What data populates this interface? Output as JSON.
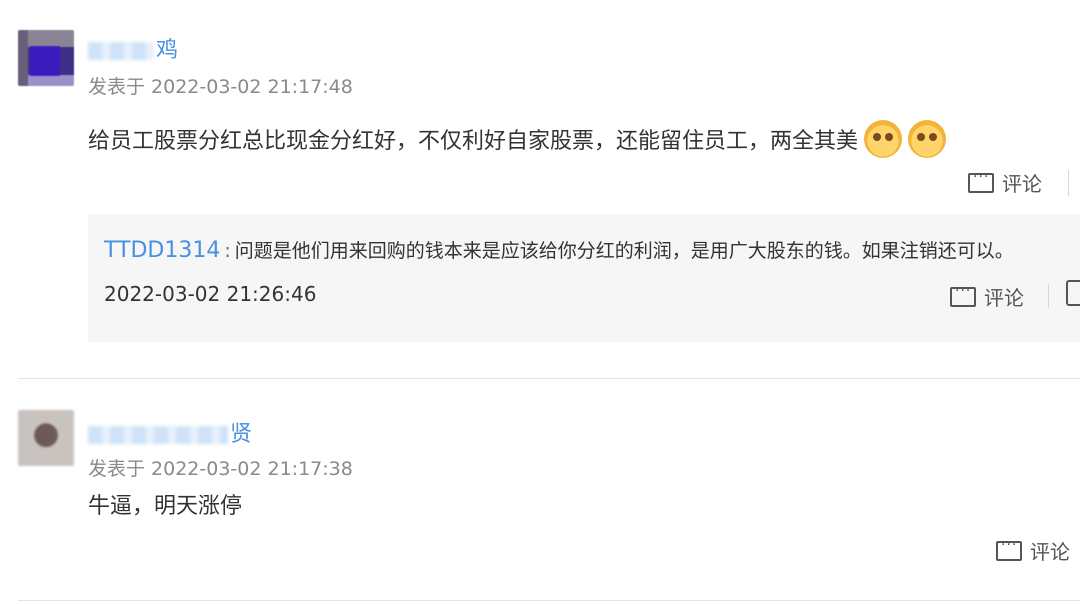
{
  "posts": [
    {
      "username_visible": "鸡",
      "time": "发表于 2022-03-02 21:17:48",
      "content": "给员工股票分红总比现金分红好，不仅利好自家股票，还能留住员工，两全其美",
      "emojis": [
        "doge-emoji",
        "doge-emoji"
      ],
      "comment_label": "评论",
      "replies": [
        {
          "user": "TTDD1314",
          "separator": ":",
          "text": "问题是他们用来回购的钱本来是应该给你分红的利润，是用广大股东的钱。如果注销还可以。",
          "time": "2022-03-02 21:26:46",
          "comment_label": "评论"
        }
      ]
    },
    {
      "username_visible": "贤",
      "time": "发表于 2022-03-02 21:17:38",
      "content": "牛逼，明天涨停",
      "comment_label": "评论"
    }
  ],
  "colors": {
    "link": "#4a90e2",
    "meta": "#8a8a8a",
    "reply_bg": "#f6f6f6"
  }
}
